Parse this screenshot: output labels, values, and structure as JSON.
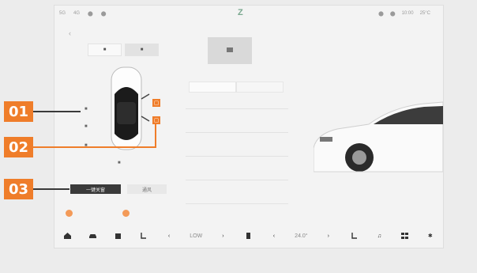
{
  "screen": {
    "status_left": [
      "5G",
      "4G",
      "⬤",
      "⬤"
    ],
    "status_right": [
      "⬤",
      "⬤",
      "10:00",
      "25°C"
    ],
    "logo": "Z",
    "back_icon": "chevron-left-icon",
    "segments": [
      "■",
      "■"
    ],
    "tabs": [
      "",
      ""
    ],
    "chip_dark": "一键关窗",
    "chip_light": "通风",
    "toggle_1": "",
    "toggle_2": "",
    "bottom": {
      "fan_left": "LOW",
      "temp": "24.0°"
    }
  },
  "callouts": {
    "c1": "01",
    "c2": "02",
    "c3": "03"
  },
  "colors": {
    "accent": "#ef7d2a",
    "dark": "#3a3a3a"
  }
}
